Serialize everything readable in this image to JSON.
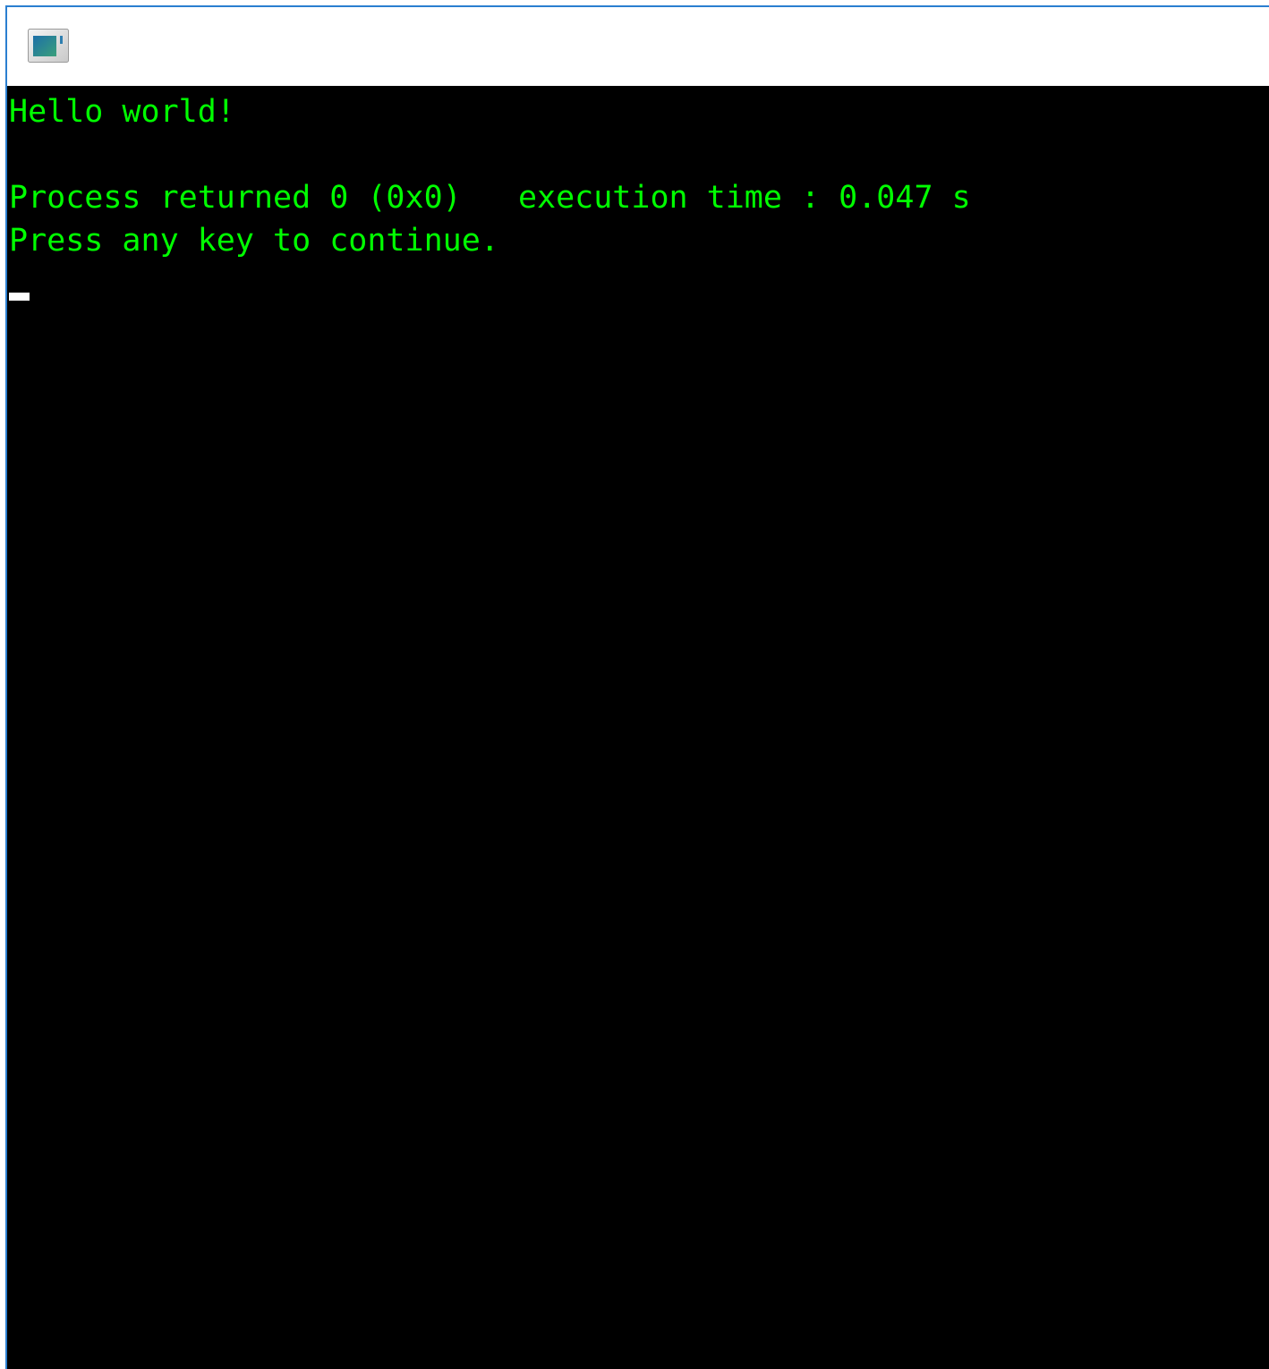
{
  "window": {
    "app_icon": "console-window-icon"
  },
  "console": {
    "lines": [
      "Hello world!",
      "",
      "Process returned 0 (0x0)   execution time : 0.047 s",
      "Press any key to continue."
    ]
  },
  "colors": {
    "text": "#00ff00",
    "background": "#000000",
    "border": "#2b7fd0"
  }
}
